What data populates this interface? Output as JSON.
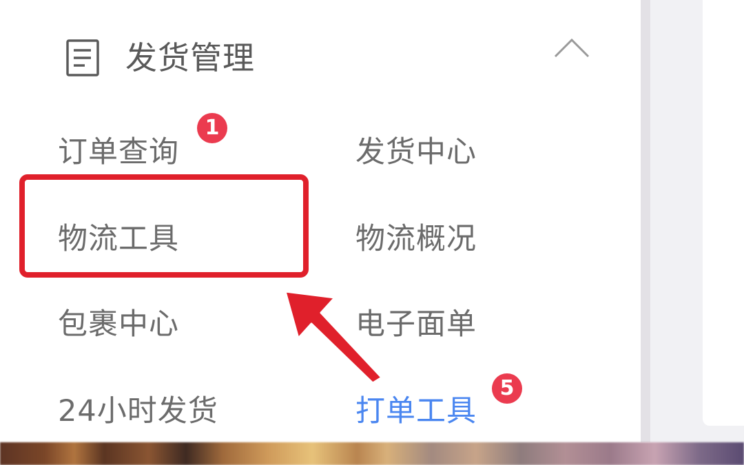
{
  "section": {
    "title": "发货管理",
    "icon": "document-icon",
    "collapse_icon": "chevron-up-icon"
  },
  "menu": {
    "items": [
      {
        "label": "订单查询",
        "badge": "1"
      },
      {
        "label": "发货中心"
      },
      {
        "label": "物流工具"
      },
      {
        "label": "物流概况"
      },
      {
        "label": "包裹中心"
      },
      {
        "label": "电子面单"
      },
      {
        "label": "24小时发货"
      },
      {
        "label": "打单工具",
        "badge": "5",
        "active": true
      }
    ]
  },
  "annotations": {
    "highlight": "物流工具",
    "arrow_color": "#e0202b"
  },
  "colors": {
    "text": "#6b6b6b",
    "active": "#4a86f0",
    "badge": "#eb3b4f",
    "highlight": "#e0202b"
  }
}
